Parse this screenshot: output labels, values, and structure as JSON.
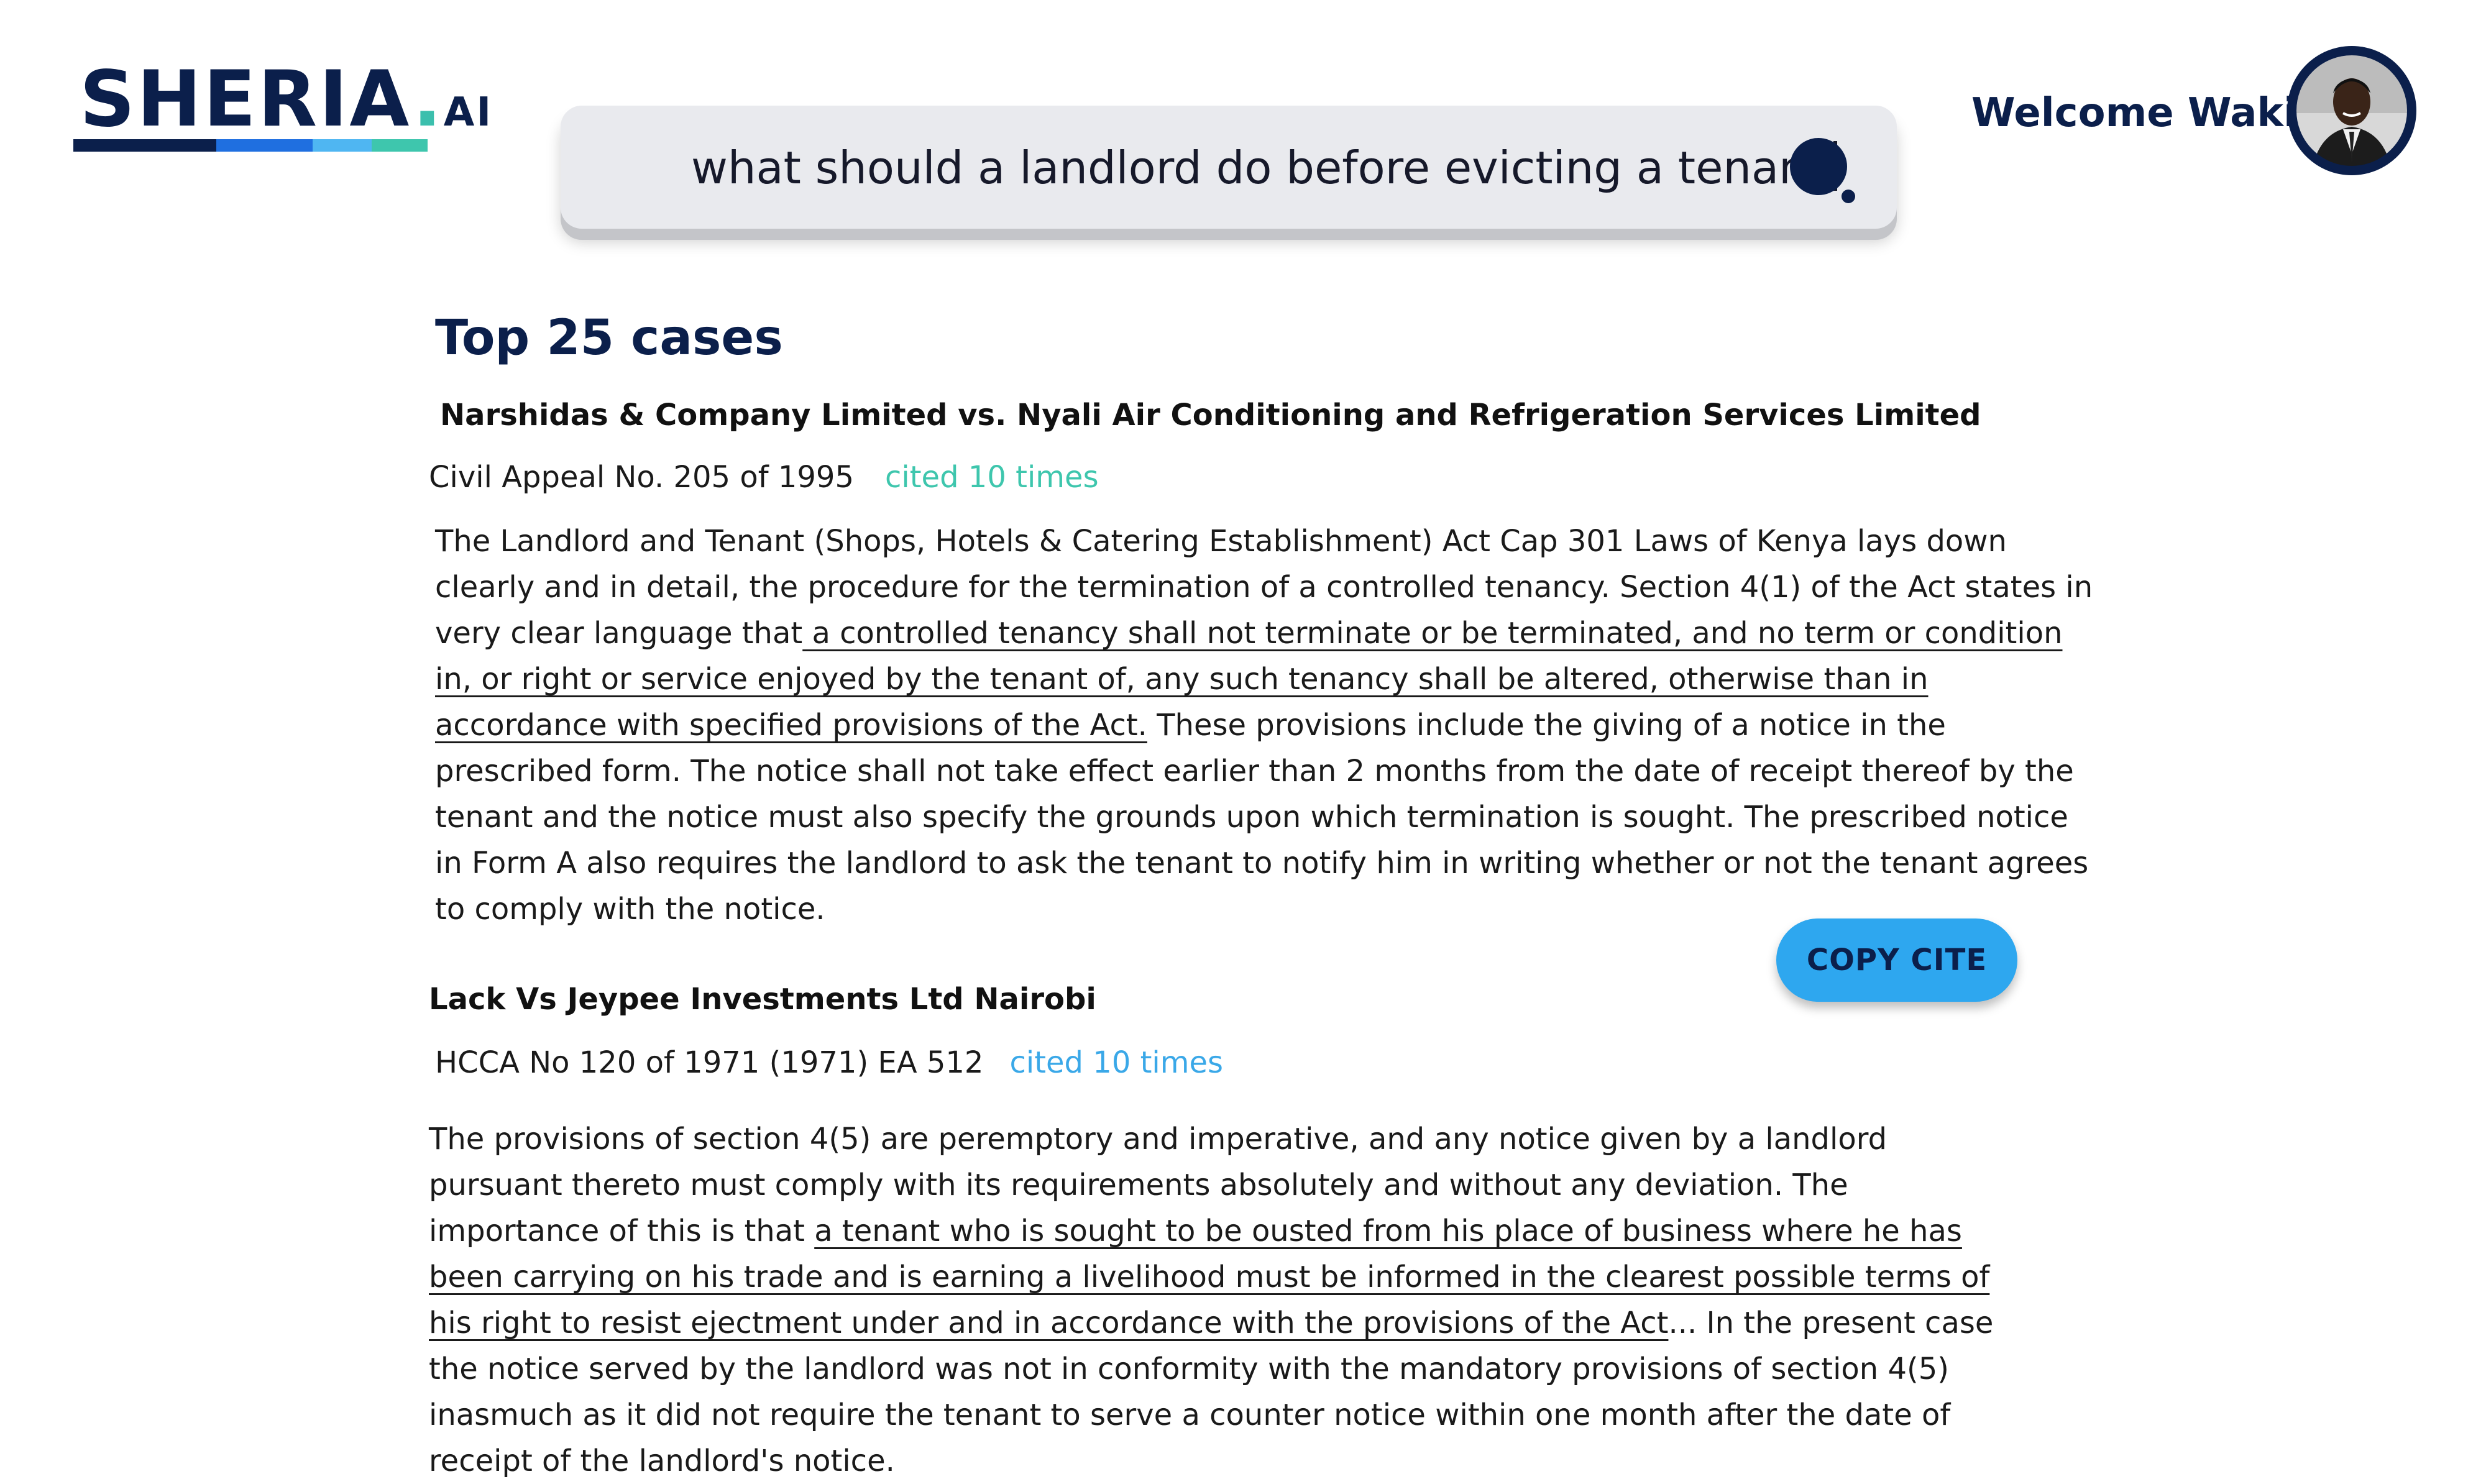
{
  "app": {
    "logo_main": "SHERIA",
    "logo_dot": ".",
    "logo_suffix": "AI",
    "logo_bar_colors": [
      "#0b1f4b",
      "#1f6fe0",
      "#4fb6f2",
      "#3ec6ad"
    ]
  },
  "search": {
    "query": "what should a landlord do before evicting a tenant",
    "icon": "search-icon"
  },
  "user": {
    "welcome": "Welcome Wakili",
    "avatar": "user-avatar-photo"
  },
  "results": {
    "heading": "Top 25 cases",
    "copy_cite_label": "COPY CITE",
    "cases": [
      {
        "title": "Narshidas & Company Limited vs. Nyali Air Conditioning and Refrigeration Services Limited",
        "citation": "Civil Appeal No. 205 of 1995",
        "cited": "cited 10 times",
        "cited_color": "#3ec6ad",
        "excerpt_before": "The Landlord and Tenant (Shops, Hotels & Catering Establishment) Act Cap 301 Laws of Kenya lays down clearly and in detail, the procedure for the termination of a controlled tenancy. Section 4(1) of the Act states in very clear language that",
        "excerpt_underlined": " a controlled tenancy shall not terminate or be terminated, and no term or condition in, or right or service enjoyed by the tenant of, any such tenancy shall be altered, otherwise than in accordance with specified  provisions of the Act.",
        "excerpt_after": " These provisions include the giving of a notice in the prescribed form. The notice shall not take effect earlier than 2 months from the date of receipt thereof by the tenant and the notice must also specify the grounds upon which termination is sought. The prescribed notice in Form A also requires the landlord to ask the tenant to notify him in writing whether or not the tenant agrees to comply with the notice."
      },
      {
        "title": "Lack Vs Jeypee Investments Ltd Nairobi",
        "citation": "HCCA No 120 of 1971 (1971) EA 512",
        "cited": "cited 10 times",
        "cited_color": "#3aa8e8",
        "excerpt_before": "The provisions of section 4(5) are peremptory and imperative, and any notice given by a landlord pursuant thereto must comply with its requirements absolutely and without any deviation. The importance of this is that ",
        "excerpt_underlined": "a tenant who is sought to be ousted from his place of business where he has been carrying on his trade and is earning a livelihood must be informed in the clearest possible terms of his right to resist ejectment under and in accordance with the provisions of the Act",
        "excerpt_after": "... In the present case the notice served by the landlord was not in conformity with the mandatory provisions of section 4(5) inasmuch as it did not require the tenant to serve a counter notice within one month after the date of receipt of the landlord's notice."
      }
    ]
  }
}
